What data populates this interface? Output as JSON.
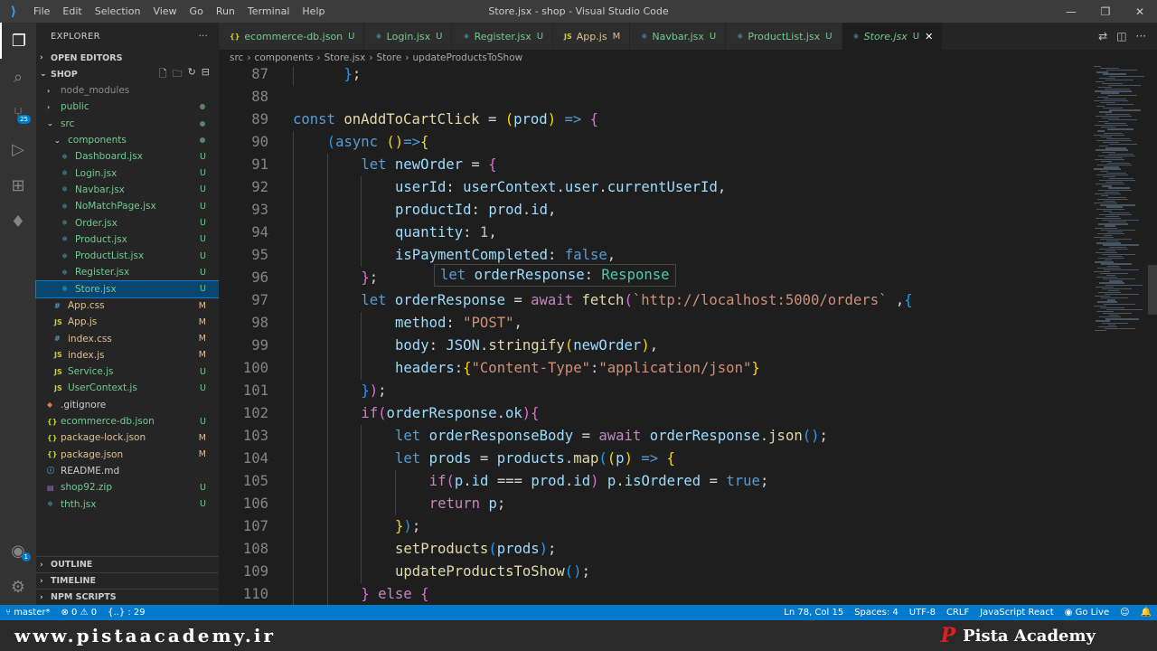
{
  "window": {
    "title": "Store.jsx - shop - Visual Studio Code",
    "menu": [
      "File",
      "Edit",
      "Selection",
      "View",
      "Go",
      "Run",
      "Terminal",
      "Help"
    ]
  },
  "activity_bar": {
    "source_control_badge": "25",
    "accounts_badge": "1"
  },
  "sidebar": {
    "title": "EXPLORER",
    "more_label": "···",
    "open_editors": "OPEN EDITORS",
    "project": "SHOP",
    "items": [
      {
        "label": "node_modules",
        "type": "folder",
        "depth": 1,
        "status": "",
        "color": "#8c8c8c"
      },
      {
        "label": "public",
        "type": "folder",
        "depth": 1,
        "status": "dot",
        "color": "#73c991"
      },
      {
        "label": "src",
        "type": "folder-open",
        "depth": 1,
        "status": "dot",
        "color": "#73c991"
      },
      {
        "label": "components",
        "type": "folder-open",
        "depth": 2,
        "status": "dot",
        "color": "#73c991"
      },
      {
        "label": "Dashboard.jsx",
        "type": "react",
        "depth": 3,
        "status": "U",
        "color": "#73c991"
      },
      {
        "label": "Login.jsx",
        "type": "react",
        "depth": 3,
        "status": "U",
        "color": "#73c991"
      },
      {
        "label": "Navbar.jsx",
        "type": "react",
        "depth": 3,
        "status": "U",
        "color": "#73c991"
      },
      {
        "label": "NoMatchPage.jsx",
        "type": "react",
        "depth": 3,
        "status": "U",
        "color": "#73c991"
      },
      {
        "label": "Order.jsx",
        "type": "react",
        "depth": 3,
        "status": "U",
        "color": "#73c991"
      },
      {
        "label": "Product.jsx",
        "type": "react",
        "depth": 3,
        "status": "U",
        "color": "#73c991"
      },
      {
        "label": "ProductList.jsx",
        "type": "react",
        "depth": 3,
        "status": "U",
        "color": "#73c991"
      },
      {
        "label": "Register.jsx",
        "type": "react",
        "depth": 3,
        "status": "U",
        "color": "#73c991"
      },
      {
        "label": "Store.jsx",
        "type": "react",
        "depth": 3,
        "status": "U",
        "color": "#73c991",
        "selected": true
      },
      {
        "label": "App.css",
        "type": "css",
        "depth": 2,
        "status": "M",
        "color": "#e2c08d"
      },
      {
        "label": "App.js",
        "type": "js",
        "depth": 2,
        "status": "M",
        "color": "#e2c08d"
      },
      {
        "label": "index.css",
        "type": "css",
        "depth": 2,
        "status": "M",
        "color": "#e2c08d"
      },
      {
        "label": "index.js",
        "type": "js",
        "depth": 2,
        "status": "M",
        "color": "#e2c08d"
      },
      {
        "label": "Service.js",
        "type": "js",
        "depth": 2,
        "status": "U",
        "color": "#73c991"
      },
      {
        "label": "UserContext.js",
        "type": "js",
        "depth": 2,
        "status": "U",
        "color": "#73c991"
      },
      {
        "label": ".gitignore",
        "type": "git",
        "depth": 1,
        "status": "",
        "color": "#cccccc"
      },
      {
        "label": "ecommerce-db.json",
        "type": "json",
        "depth": 1,
        "status": "U",
        "color": "#73c991"
      },
      {
        "label": "package-lock.json",
        "type": "json",
        "depth": 1,
        "status": "M",
        "color": "#e2c08d"
      },
      {
        "label": "package.json",
        "type": "json",
        "depth": 1,
        "status": "M",
        "color": "#e2c08d"
      },
      {
        "label": "README.md",
        "type": "md",
        "depth": 1,
        "status": "",
        "color": "#cccccc"
      },
      {
        "label": "shop92.zip",
        "type": "zip",
        "depth": 1,
        "status": "U",
        "color": "#73c991"
      },
      {
        "label": "thth.jsx",
        "type": "react",
        "depth": 1,
        "status": "U",
        "color": "#73c991"
      }
    ],
    "bottom_sections": [
      "OUTLINE",
      "TIMELINE",
      "NPM SCRIPTS"
    ]
  },
  "tabs": [
    {
      "icon": "{}",
      "label": "ecommerce-db.json",
      "status": "U",
      "color": "#73c991"
    },
    {
      "icon": "⚛",
      "label": "Login.jsx",
      "status": "U",
      "color": "#73c991"
    },
    {
      "icon": "⚛",
      "label": "Register.jsx",
      "status": "U",
      "color": "#73c991"
    },
    {
      "icon": "JS",
      "label": "App.js",
      "status": "M",
      "color": "#e2c08d"
    },
    {
      "icon": "⚛",
      "label": "Navbar.jsx",
      "status": "U",
      "color": "#73c991"
    },
    {
      "icon": "⚛",
      "label": "ProductList.jsx",
      "status": "U",
      "color": "#73c991"
    },
    {
      "icon": "⚛",
      "label": "Store.jsx",
      "status": "U",
      "color": "#73c991",
      "active": true,
      "close": "✕"
    }
  ],
  "breadcrumb": [
    "src",
    "components",
    "Store.jsx",
    "Store",
    "updateProductsToShow"
  ],
  "editor": {
    "lines": [
      {
        "n": "87",
        "indent": 1,
        "tokens": [
          [
            "  ",
            ""
          ],
          [
            "}",
            "br3"
          ],
          [
            ";",
            ""
          ]
        ]
      },
      {
        "n": "88",
        "indent": 0,
        "tokens": []
      },
      {
        "n": "89",
        "indent": 0,
        "tokens": [
          [
            "const ",
            "kw"
          ],
          [
            "onAddToCartClick",
            "fn"
          ],
          [
            " = ",
            ""
          ],
          [
            "(",
            "br1"
          ],
          [
            "prod",
            "var"
          ],
          [
            ")",
            "br1"
          ],
          [
            " ",
            ""
          ],
          [
            "=>",
            "kw"
          ],
          [
            " ",
            ""
          ],
          [
            "{",
            "br2"
          ]
        ]
      },
      {
        "n": "90",
        "indent": 1,
        "tokens": [
          [
            "(",
            "br3"
          ],
          [
            "async",
            "kw"
          ],
          [
            " ",
            ""
          ],
          [
            "()",
            "br1"
          ],
          [
            "=>",
            "kw"
          ],
          [
            "{",
            "br1"
          ]
        ]
      },
      {
        "n": "91",
        "indent": 2,
        "tokens": [
          [
            "let ",
            "kw"
          ],
          [
            "newOrder",
            "var"
          ],
          [
            " = ",
            ""
          ],
          [
            "{",
            "br2"
          ]
        ]
      },
      {
        "n": "92",
        "indent": 3,
        "tokens": [
          [
            "userId",
            "var"
          ],
          [
            ": ",
            ""
          ],
          [
            "userContext",
            "var"
          ],
          [
            ".",
            ""
          ],
          [
            "user",
            "var"
          ],
          [
            ".",
            ""
          ],
          [
            "currentUserId",
            "var"
          ],
          [
            ",",
            ""
          ]
        ]
      },
      {
        "n": "93",
        "indent": 3,
        "tokens": [
          [
            "productId",
            "var"
          ],
          [
            ": ",
            ""
          ],
          [
            "prod",
            "var"
          ],
          [
            ".",
            ""
          ],
          [
            "id",
            "var"
          ],
          [
            ",",
            ""
          ]
        ]
      },
      {
        "n": "94",
        "indent": 3,
        "tokens": [
          [
            "quantity",
            "var"
          ],
          [
            ": ",
            ""
          ],
          [
            "1",
            "num"
          ],
          [
            ",",
            ""
          ]
        ]
      },
      {
        "n": "95",
        "indent": 3,
        "tokens": [
          [
            "isPaymentCompleted",
            "var"
          ],
          [
            ": ",
            ""
          ],
          [
            "false",
            "kw"
          ],
          [
            ",",
            ""
          ]
        ]
      },
      {
        "n": "96",
        "indent": 2,
        "tokens": [
          [
            "}",
            "br2"
          ],
          [
            ";",
            ""
          ]
        ]
      },
      {
        "n": "97",
        "indent": 2,
        "tokens": [
          [
            "let ",
            "kw"
          ],
          [
            "orderResponse",
            "var"
          ],
          [
            " = ",
            ""
          ],
          [
            "await ",
            "ctl"
          ],
          [
            "fetch",
            "fn"
          ],
          [
            "(",
            "br2"
          ],
          [
            "`",
            "str"
          ],
          [
            "http://localhost:5000/orders",
            "str"
          ],
          [
            "`",
            "str"
          ],
          [
            " ,",
            ""
          ],
          [
            "{",
            "br3"
          ]
        ]
      },
      {
        "n": "98",
        "indent": 3,
        "tokens": [
          [
            "method",
            "var"
          ],
          [
            ": ",
            ""
          ],
          [
            "\"POST\"",
            "str"
          ],
          [
            ",",
            ""
          ]
        ]
      },
      {
        "n": "99",
        "indent": 3,
        "tokens": [
          [
            "body",
            "var"
          ],
          [
            ": ",
            ""
          ],
          [
            "JSON",
            "var"
          ],
          [
            ".",
            ""
          ],
          [
            "stringify",
            "fn"
          ],
          [
            "(",
            "br1"
          ],
          [
            "newOrder",
            "var"
          ],
          [
            ")",
            "br1"
          ],
          [
            ",",
            ""
          ]
        ]
      },
      {
        "n": "100",
        "indent": 3,
        "tokens": [
          [
            "headers",
            "var"
          ],
          [
            ":",
            ""
          ],
          [
            "{",
            "br1"
          ],
          [
            "\"Content-Type\"",
            "str"
          ],
          [
            ":",
            ""
          ],
          [
            "\"application/json\"",
            "str"
          ],
          [
            "}",
            "br1"
          ]
        ]
      },
      {
        "n": "101",
        "indent": 2,
        "tokens": [
          [
            "}",
            "br3"
          ],
          [
            ")",
            "br2"
          ],
          [
            ";",
            ""
          ]
        ]
      },
      {
        "n": "102",
        "indent": 2,
        "tokens": [
          [
            "if",
            "ctl"
          ],
          [
            "(",
            "br2"
          ],
          [
            "orderResponse",
            "var"
          ],
          [
            ".",
            ""
          ],
          [
            "ok",
            "var"
          ],
          [
            ")",
            "br2"
          ],
          [
            "{",
            "br2"
          ]
        ]
      },
      {
        "n": "103",
        "indent": 3,
        "tokens": [
          [
            "let ",
            "kw"
          ],
          [
            "orderResponseBody",
            "var"
          ],
          [
            " = ",
            ""
          ],
          [
            "await ",
            "ctl"
          ],
          [
            "orderResponse",
            "var"
          ],
          [
            ".",
            ""
          ],
          [
            "json",
            "fn"
          ],
          [
            "()",
            "br3"
          ],
          [
            ";",
            ""
          ]
        ]
      },
      {
        "n": "104",
        "indent": 3,
        "tokens": [
          [
            "let ",
            "kw"
          ],
          [
            "prods",
            "var"
          ],
          [
            " = ",
            ""
          ],
          [
            "products",
            "var"
          ],
          [
            ".",
            ""
          ],
          [
            "map",
            "fn"
          ],
          [
            "(",
            "br3"
          ],
          [
            "(",
            "br1"
          ],
          [
            "p",
            "var"
          ],
          [
            ")",
            "br1"
          ],
          [
            " ",
            ""
          ],
          [
            "=>",
            "kw"
          ],
          [
            " ",
            ""
          ],
          [
            "{",
            "br1"
          ]
        ]
      },
      {
        "n": "105",
        "indent": 4,
        "tokens": [
          [
            "if",
            "ctl"
          ],
          [
            "(",
            "br2"
          ],
          [
            "p",
            "var"
          ],
          [
            ".",
            ""
          ],
          [
            "id",
            "var"
          ],
          [
            " === ",
            ""
          ],
          [
            "prod",
            "var"
          ],
          [
            ".",
            ""
          ],
          [
            "id",
            "var"
          ],
          [
            ")",
            "br2"
          ],
          [
            " ",
            ""
          ],
          [
            "p",
            "var"
          ],
          [
            ".",
            ""
          ],
          [
            "isOrdered",
            "var"
          ],
          [
            " = ",
            ""
          ],
          [
            "true",
            "kw"
          ],
          [
            ";",
            ""
          ]
        ]
      },
      {
        "n": "106",
        "indent": 4,
        "tokens": [
          [
            "return ",
            "ctl"
          ],
          [
            "p",
            "var"
          ],
          [
            ";",
            ""
          ]
        ]
      },
      {
        "n": "107",
        "indent": 3,
        "tokens": [
          [
            "}",
            "br1"
          ],
          [
            ")",
            "br3"
          ],
          [
            ";",
            ""
          ]
        ]
      },
      {
        "n": "108",
        "indent": 3,
        "tokens": [
          [
            "setProducts",
            "fn"
          ],
          [
            "(",
            "br3"
          ],
          [
            "prods",
            "var"
          ],
          [
            ")",
            "br3"
          ],
          [
            ";",
            ""
          ]
        ]
      },
      {
        "n": "109",
        "indent": 3,
        "tokens": [
          [
            "updateProductsToShow",
            "fn"
          ],
          [
            "()",
            "br3"
          ],
          [
            ";",
            ""
          ]
        ]
      },
      {
        "n": "110",
        "indent": 2,
        "tokens": [
          [
            "}",
            "br2"
          ],
          [
            " ",
            ""
          ],
          [
            "else",
            "ctl"
          ],
          [
            " ",
            ""
          ],
          [
            "{",
            "br2"
          ]
        ]
      }
    ],
    "hover_hint": {
      "kw": "let ",
      "name": "orderResponse",
      "sep": ": ",
      "type": "Response"
    }
  },
  "statusbar": {
    "branch": "master*",
    "errors": "0",
    "warnings": "0",
    "language_scope": "{..} : 29",
    "position": "Ln 78, Col 15",
    "spaces": "Spaces: 4",
    "encoding": "UTF-8",
    "eol": "CRLF",
    "language": "JavaScript React",
    "go_live": "Go Live"
  },
  "watermark": {
    "url": "www.pistaacademy.ir",
    "brand": "Pista Academy",
    "logo": "P"
  }
}
